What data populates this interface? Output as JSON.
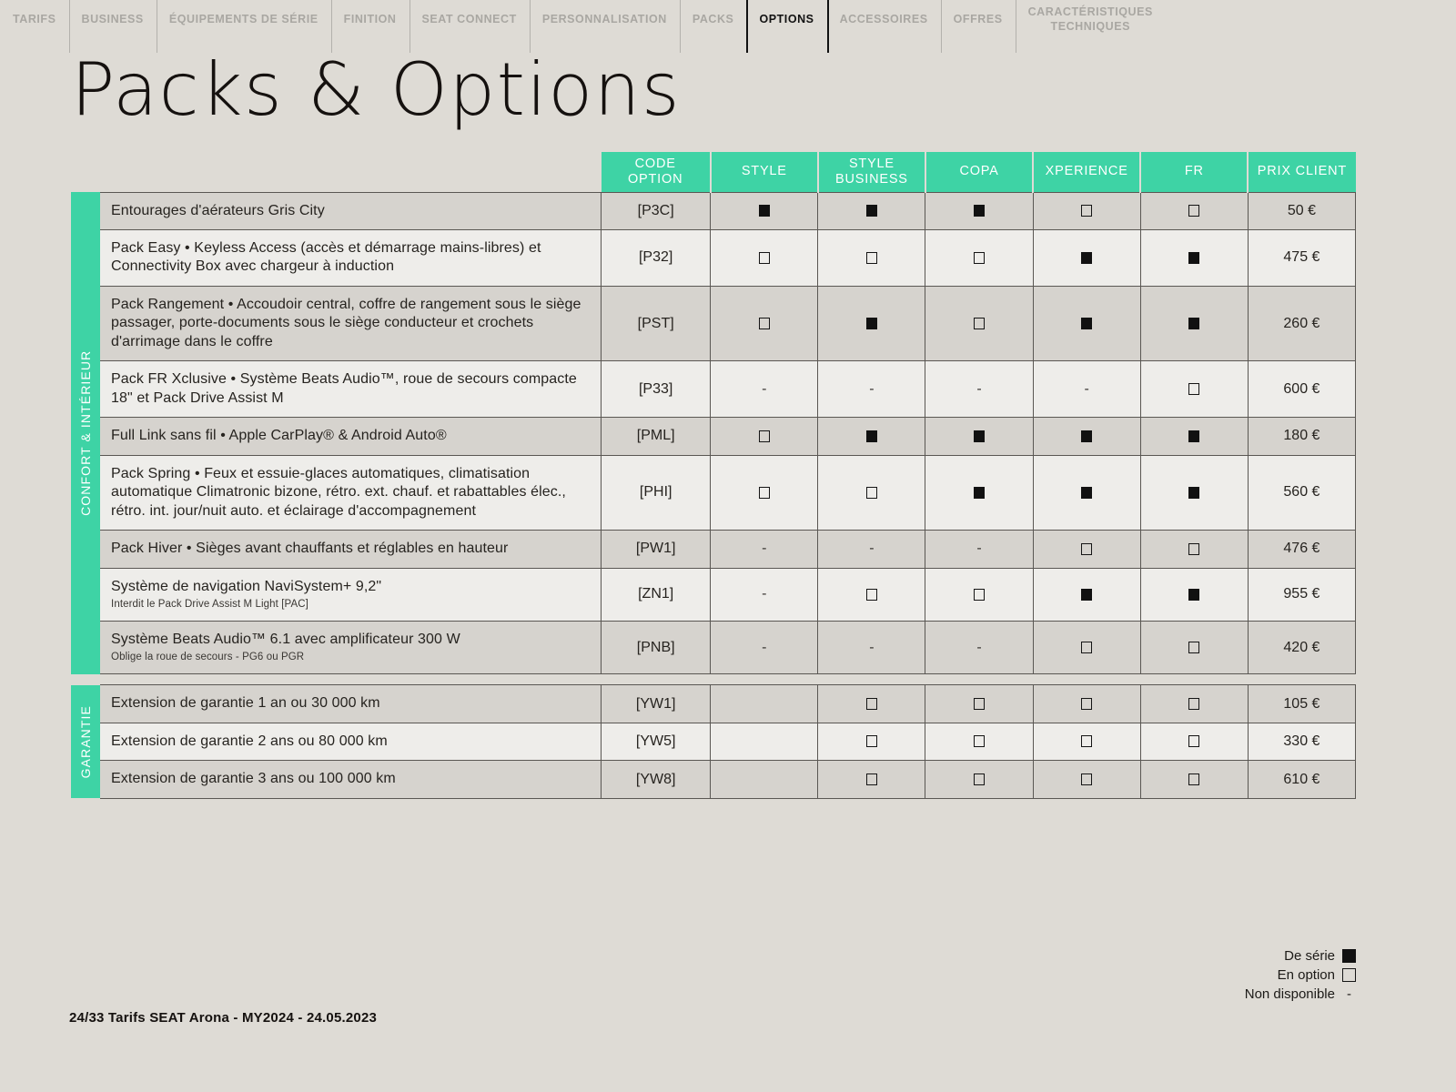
{
  "nav": {
    "items": [
      {
        "label": "TARIFS",
        "active": false
      },
      {
        "label": "BUSINESS",
        "active": false
      },
      {
        "label": "ÉQUIPEMENTS DE SÉRIE",
        "active": false
      },
      {
        "label": "FINITION",
        "active": false
      },
      {
        "label": "SEAT CONNECT",
        "active": false
      },
      {
        "label": "PERSONNALISATION",
        "active": false
      },
      {
        "label": "PACKS",
        "active": false
      },
      {
        "label": "OPTIONS",
        "active": true
      },
      {
        "label": "ACCESSOIRES",
        "active": false
      },
      {
        "label": "OFFRES",
        "active": false
      },
      {
        "label": "CARACTÉRISTIQUES\nTECHNIQUES",
        "active": false
      }
    ]
  },
  "page_title": "Packs & Options",
  "table": {
    "headers": {
      "code": "CODE\nOPTION",
      "style": "STYLE",
      "style_business": "STYLE\nBUSINESS",
      "copa": "COPA",
      "xperience": "XPERIENCE",
      "fr": "FR",
      "price": "PRIX CLIENT"
    },
    "sections": [
      {
        "band_label": "CONFORT & INTÉRIEUR",
        "rows": [
          {
            "desc": "Entourages d'aérateurs Gris City",
            "sub": "",
            "code": "[P3C]",
            "style": "filled",
            "style_business": "filled",
            "copa": "filled",
            "xperience": "empty",
            "fr": "empty",
            "price": "50 €"
          },
          {
            "desc": "Pack Easy • Keyless Access (accès et démarrage mains-libres) et Connectivity Box avec chargeur à induction",
            "sub": "",
            "code": "[P32]",
            "style": "empty",
            "style_business": "empty",
            "copa": "empty",
            "xperience": "filled",
            "fr": "filled",
            "price": "475 €"
          },
          {
            "desc": "Pack Rangement • Accoudoir central, coffre de rangement sous le siège passager, porte-documents sous le siège conducteur et crochets d'arrimage dans le coffre",
            "sub": "",
            "code": "[PST]",
            "style": "empty",
            "style_business": "filled",
            "copa": "empty",
            "xperience": "filled",
            "fr": "filled",
            "price": "260 €"
          },
          {
            "desc": "Pack FR Xclusive • Système Beats Audio™, roue de secours compacte 18\" et Pack Drive Assist M",
            "sub": "",
            "code": "[P33]",
            "style": "dash",
            "style_business": "dash",
            "copa": "dash",
            "xperience": "dash",
            "fr": "empty",
            "price": "600 €"
          },
          {
            "desc": "Full Link sans fil • Apple CarPlay® & Android Auto®",
            "sub": "",
            "code": "[PML]",
            "style": "empty",
            "style_business": "filled",
            "copa": "filled",
            "xperience": "filled",
            "fr": "filled",
            "price": "180 €"
          },
          {
            "desc": "Pack Spring • Feux et essuie-glaces automatiques, climatisation automatique Climatronic bizone, rétro. ext. chauf. et rabattables élec., rétro. int. jour/nuit auto. et éclairage d'accompagnement",
            "sub": "",
            "code": "[PHI]",
            "style": "empty",
            "style_business": "empty",
            "copa": "filled",
            "xperience": "filled",
            "fr": "filled",
            "price": "560 €"
          },
          {
            "desc": "Pack Hiver • Sièges avant chauffants et réglables en hauteur",
            "sub": "",
            "code": "[PW1]",
            "style": "dash",
            "style_business": "dash",
            "copa": "dash",
            "xperience": "empty",
            "fr": "empty",
            "price": "476 €"
          },
          {
            "desc": "Système de navigation NaviSystem+ 9,2\"",
            "sub": "Interdit le Pack Drive Assist M Light [PAC]",
            "code": "[ZN1]",
            "style": "dash",
            "style_business": "empty",
            "copa": "empty",
            "xperience": "filled",
            "fr": "filled",
            "price": "955 €"
          },
          {
            "desc": "Système Beats Audio™  6.1 avec amplificateur 300 W",
            "sub": "Oblige la roue de secours - PG6 ou PGR",
            "code": "[PNB]",
            "style": "dash",
            "style_business": "dash",
            "copa": "dash",
            "xperience": "empty",
            "fr": "empty",
            "price": "420 €"
          }
        ]
      },
      {
        "band_label": "GARANTIE",
        "rows": [
          {
            "desc": "Extension de garantie 1 an ou 30 000 km",
            "sub": "",
            "code": "[YW1]",
            "style": "none",
            "style_business": "empty",
            "copa": "empty",
            "xperience": "empty",
            "fr": "empty",
            "price": "105 €"
          },
          {
            "desc": "Extension de garantie 2 ans ou 80 000 km",
            "sub": "",
            "code": "[YW5]",
            "style": "none",
            "style_business": "empty",
            "copa": "empty",
            "xperience": "empty",
            "fr": "empty",
            "price": "330 €"
          },
          {
            "desc": "Extension de garantie 3 ans ou 100 000 km",
            "sub": "",
            "code": "[YW8]",
            "style": "none",
            "style_business": "empty",
            "copa": "empty",
            "xperience": "empty",
            "fr": "empty",
            "price": "610 €"
          }
        ]
      }
    ]
  },
  "legend": {
    "standard": "De série",
    "option": "En option",
    "unavailable": "Non disponible",
    "unavailable_symbol": "-"
  },
  "footer": "24/33  Tarifs SEAT Arona - MY2024 - 24.05.2023",
  "colors": {
    "accent": "#3ed3a5",
    "page_bg": "#dedbd5",
    "row_dark": "#d6d3ce",
    "row_light": "#eeedea",
    "text": "#26231f"
  }
}
